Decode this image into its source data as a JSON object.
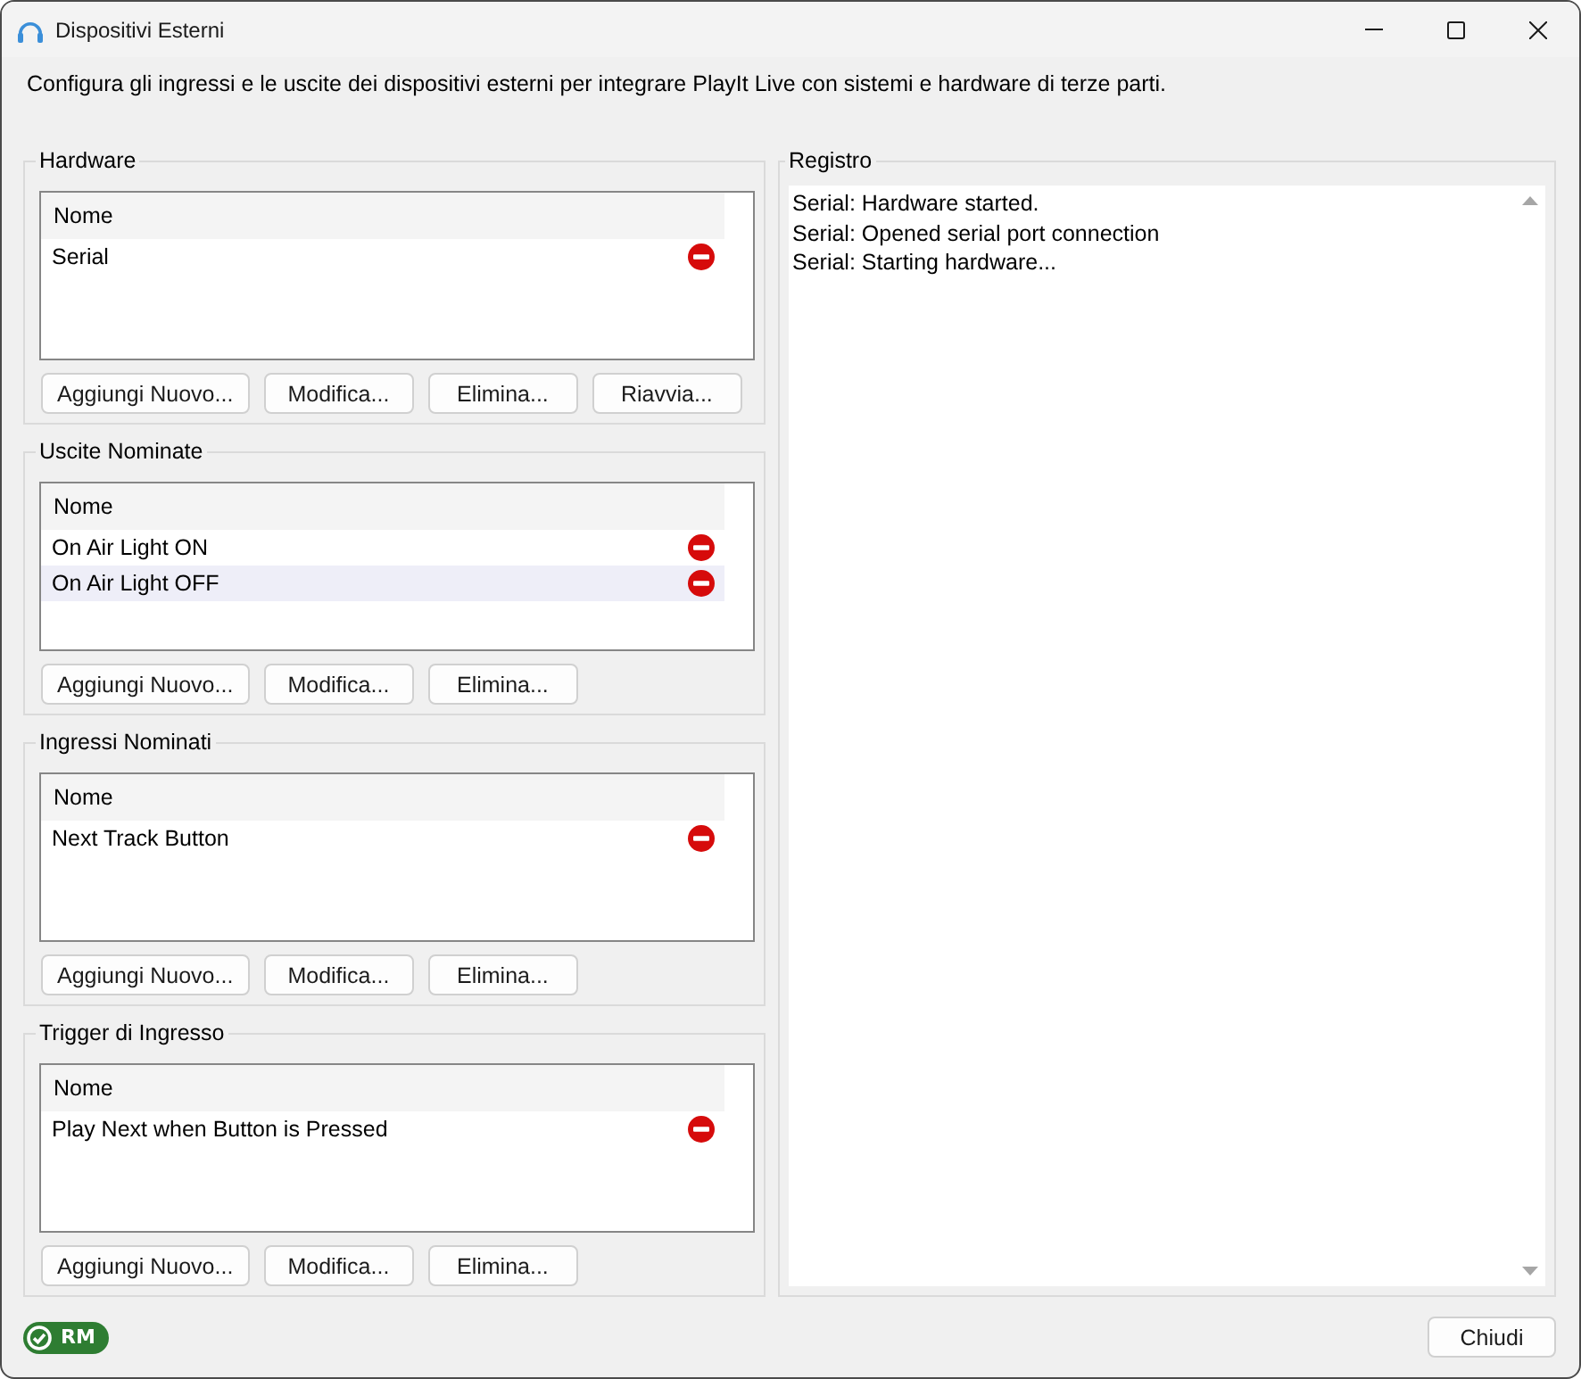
{
  "window": {
    "title": "Dispositivi Esterni"
  },
  "description": "Configura gli ingressi e le uscite dei dispositivi esterni per integrare PlayIt Live con sistemi e hardware di terze parti.",
  "groups": [
    {
      "title": "Hardware",
      "column": "Nome",
      "rows": [
        {
          "name": "Serial",
          "selected": false
        }
      ],
      "buttons": [
        "Aggiungi Nuovo...",
        "Modifica...",
        "Elimina...",
        "Riavvia..."
      ]
    },
    {
      "title": "Uscite Nominate",
      "column": "Nome",
      "rows": [
        {
          "name": "On Air Light ON",
          "selected": false
        },
        {
          "name": "On Air Light OFF",
          "selected": true
        }
      ],
      "buttons": [
        "Aggiungi Nuovo...",
        "Modifica...",
        "Elimina..."
      ]
    },
    {
      "title": "Ingressi Nominati",
      "column": "Nome",
      "rows": [
        {
          "name": "Next Track Button",
          "selected": false
        }
      ],
      "buttons": [
        "Aggiungi Nuovo...",
        "Modifica...",
        "Elimina..."
      ]
    },
    {
      "title": "Trigger di Ingresso",
      "column": "Nome",
      "rows": [
        {
          "name": "Play Next when Button is Pressed",
          "selected": false
        }
      ],
      "buttons": [
        "Aggiungi Nuovo...",
        "Modifica...",
        "Elimina..."
      ]
    }
  ],
  "log": {
    "title": "Registro",
    "lines": [
      "Serial: Hardware started.",
      "Serial: Opened serial port connection",
      "Serial: Starting hardware..."
    ]
  },
  "footer": {
    "badge": {
      "label": "RM"
    },
    "close_button": "Chiudi"
  }
}
